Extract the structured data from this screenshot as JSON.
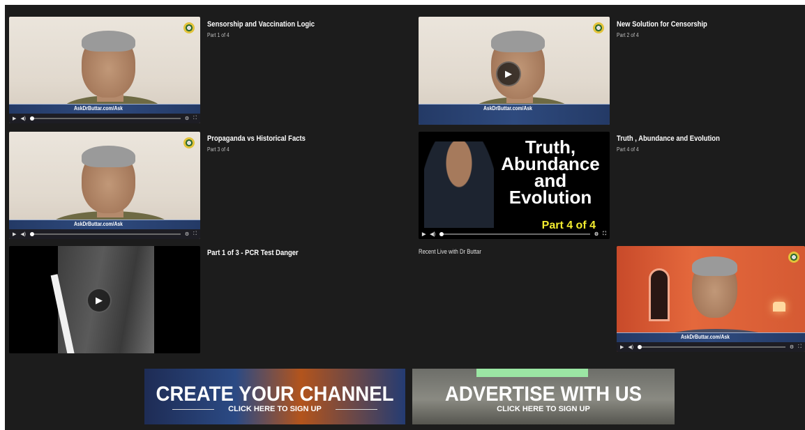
{
  "videos": [
    {
      "title": "Sensorship and Vaccination Logic",
      "subtitle": "Part 1 of 4"
    },
    {
      "title": "New Solution for Censorship",
      "subtitle": "Part 2 of 4"
    },
    {
      "title": "Propaganda vs Historical Facts",
      "subtitle": "Part 3 of 4"
    },
    {
      "title": "Truth , Abundance and Evolution",
      "subtitle": "Part 4 of 4"
    },
    {
      "title": "Part 1 of 3 - PCR Test Danger"
    },
    {
      "title": "Recent Live with Dr Buttar"
    }
  ],
  "overlay_text": {
    "banner": "AskDrButtar.com/Ask",
    "promo_title": "Truth, Abundance and Evolution",
    "promo_part": "Part 4 of 4"
  },
  "ads": {
    "create": {
      "main": "CREATE YOUR CHANNEL",
      "cta": "CLICK HERE TO SIGN UP"
    },
    "advertise": {
      "main": "ADVERTISE WITH US",
      "cta": "CLICK HERE TO SIGN UP"
    }
  },
  "colors": {
    "background": "#1c1c1c",
    "banner": "#2e4a7e",
    "promo_part": "#f3ec2f"
  },
  "icons": [
    "play-icon",
    "volume-icon",
    "settings-icon",
    "fullscreen-icon",
    "channel-logo-icon"
  ]
}
